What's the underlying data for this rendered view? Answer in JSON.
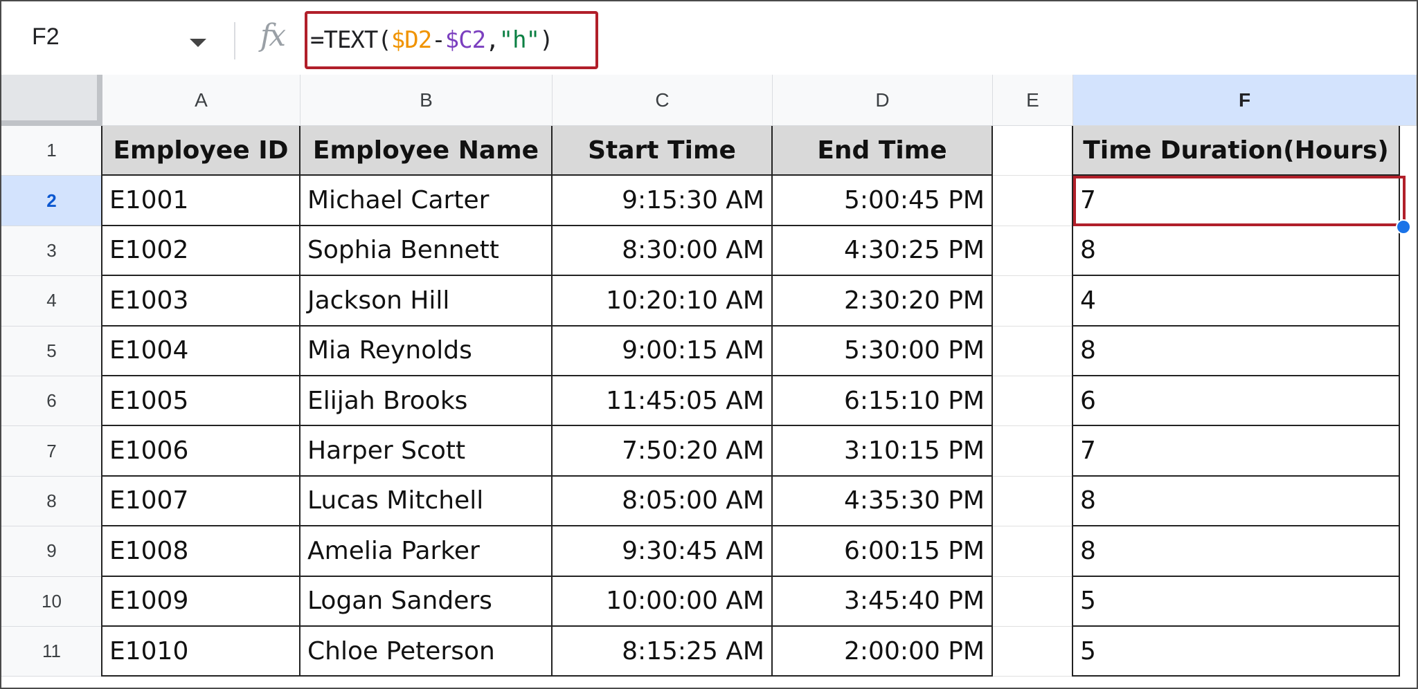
{
  "name_box": "F2",
  "formula": [
    {
      "text": "=TEXT(",
      "color": "#202124"
    },
    {
      "text": "$D2",
      "color": "#f09300"
    },
    {
      "text": "-",
      "color": "#202124"
    },
    {
      "text": "$C2",
      "color": "#7b3fbf"
    },
    {
      "text": ",",
      "color": "#202124"
    },
    {
      "text": "\"h\"",
      "color": "#0b8043"
    },
    {
      "text": ")",
      "color": "#202124"
    }
  ],
  "fx_label": "fx",
  "columns": [
    "A",
    "B",
    "C",
    "D",
    "E",
    "F"
  ],
  "selected_column": "F",
  "selected_row": 2,
  "row_numbers": [
    "1",
    "2",
    "3",
    "4",
    "5",
    "6",
    "7",
    "8",
    "9",
    "10",
    "11"
  ],
  "headers": {
    "employee_id": "Employee ID",
    "employee_name": "Employee Name",
    "start_time": "Start Time",
    "end_time": "End Time",
    "duration": "Time Duration(Hours)"
  },
  "rows": [
    {
      "id": "E1001",
      "name": "Michael Carter",
      "start": "9:15:30 AM",
      "end": "5:00:45 PM",
      "duration": "7"
    },
    {
      "id": "E1002",
      "name": "Sophia Bennett",
      "start": "8:30:00 AM",
      "end": "4:30:25 PM",
      "duration": "8"
    },
    {
      "id": "E1003",
      "name": "Jackson Hill",
      "start": "10:20:10 AM",
      "end": "2:30:20 PM",
      "duration": "4"
    },
    {
      "id": "E1004",
      "name": "Mia Reynolds",
      "start": "9:00:15 AM",
      "end": "5:30:00 PM",
      "duration": "8"
    },
    {
      "id": "E1005",
      "name": "Elijah Brooks",
      "start": "11:45:05 AM",
      "end": "6:15:10 PM",
      "duration": "6"
    },
    {
      "id": "E1006",
      "name": "Harper Scott",
      "start": "7:50:20 AM",
      "end": "3:10:15 PM",
      "duration": "7"
    },
    {
      "id": "E1007",
      "name": "Lucas Mitchell",
      "start": "8:05:00 AM",
      "end": "4:35:30 PM",
      "duration": "8"
    },
    {
      "id": "E1008",
      "name": "Amelia Parker",
      "start": "9:30:45 AM",
      "end": "6:00:15 PM",
      "duration": "8"
    },
    {
      "id": "E1009",
      "name": "Logan Sanders",
      "start": "10:00:00 AM",
      "end": "3:45:40 PM",
      "duration": "5"
    },
    {
      "id": "E1010",
      "name": "Chloe Peterson",
      "start": "8:15:25 AM",
      "end": "2:00:00 PM",
      "duration": "5"
    }
  ]
}
